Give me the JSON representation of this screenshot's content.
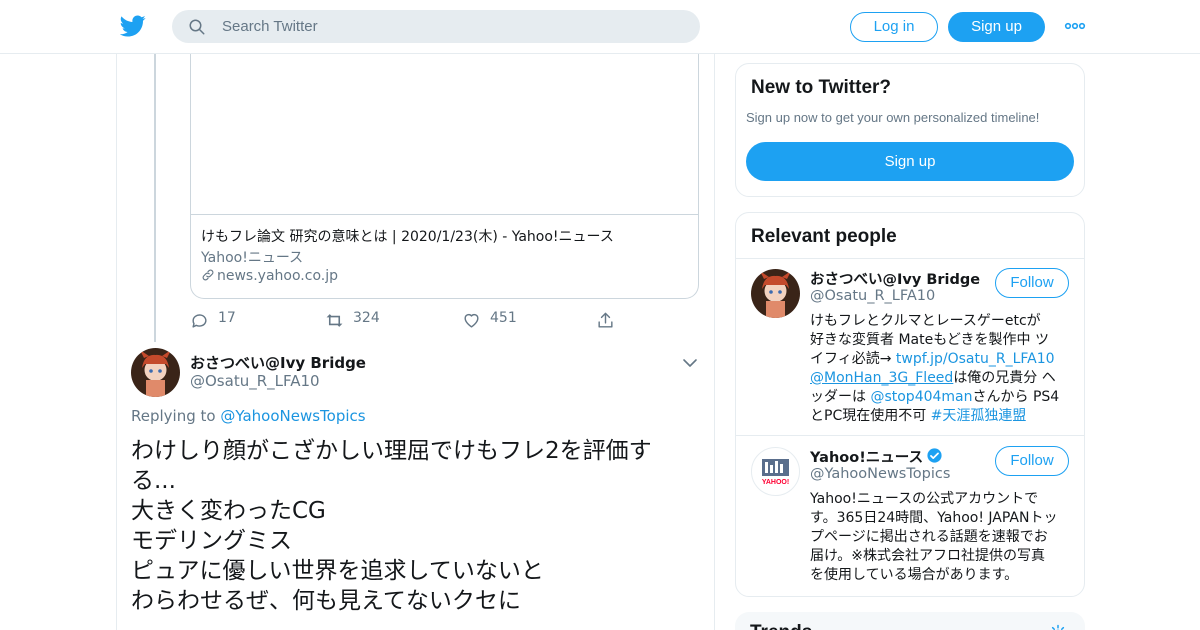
{
  "header": {
    "search_placeholder": "Search Twitter",
    "login_label": "Log in",
    "signup_label": "Sign up"
  },
  "link_card": {
    "title": "けもフレ論文 研究の意味とは | 2020/1/23(木) - Yahoo!ニュース",
    "description": "Yahoo!ニュース",
    "domain": "news.yahoo.co.jp"
  },
  "actions": {
    "replies": "17",
    "retweets": "324",
    "likes": "451"
  },
  "tweet": {
    "author_name": "おさつべい@Ivy Bridge",
    "author_handle": "@Osatu_R_LFA10",
    "replying_prefix": "Replying to",
    "replying_to": "@YahooNewsTopics",
    "lines": [
      "わけしり顔がこざかしい理屈でけもフレ2を評価す",
      "る...",
      "大きく変わったCG",
      "モデリングミス",
      "ピュアに優しい世界を追求していないと",
      "わらわせるぜ、何も見えてないクセに"
    ]
  },
  "sidebar": {
    "new_to_twitter": {
      "title": "New to Twitter?",
      "subtitle": "Sign up now to get your own personalized timeline!",
      "button": "Sign up"
    },
    "relevant_people": {
      "title": "Relevant people",
      "follow_label": "Follow",
      "people": [
        {
          "name": "おさつべい@Ivy Bridge",
          "handle": "@Osatu_R_LFA10",
          "bio": {
            "l1": "けもフレとクルマとレースゲーetcが",
            "l2": "好きな変質者 Mateもどきを製作中 ツ",
            "l3a": "イフィ必読→ ",
            "l3b": "twpf.jp/Osatu_R_LFA10",
            "l4a": "@MonHan_3G_Fleed",
            "l4b": "は俺の兄貴分 ヘ",
            "l5a": "ッダーは ",
            "l5b": "@stop404man",
            "l5c": "さんから PS4",
            "l6a": "とPC現在使用不可 ",
            "l6b": "#天涯孤独連盟"
          }
        },
        {
          "name": "Yahoo!ニュース",
          "handle": "@YahooNewsTopics",
          "avatar_text": "YAHOO!",
          "bio": {
            "l1": "Yahoo!ニュースの公式アカウントで",
            "l2": "す。365日24時間、Yahoo! JAPANトッ",
            "l3": "プページに掲出される話題を速報でお",
            "l4": "届け。※株式会社アフロ社提供の写真",
            "l5": "を使用している場合があります。"
          }
        }
      ]
    },
    "trends": {
      "title": "Trends"
    }
  },
  "colors": {
    "accent": "#1da1f2",
    "link": "#1b95e0",
    "muted": "#657786",
    "border": "#e6ecf0"
  },
  "icons": [
    "twitter-bird-icon",
    "search-icon",
    "more-icon",
    "link-icon",
    "reply-icon",
    "retweet-icon",
    "like-icon",
    "share-icon",
    "chevron-down-icon",
    "verified-icon",
    "gear-icon"
  ]
}
